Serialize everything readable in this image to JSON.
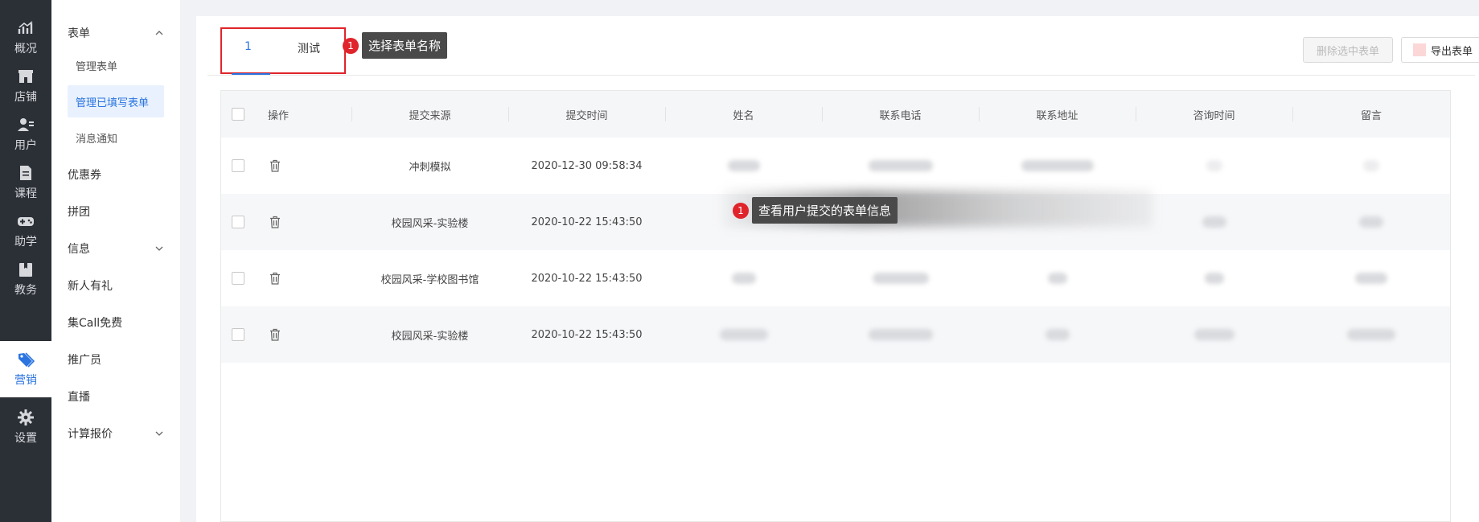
{
  "rail": {
    "items": [
      {
        "label": "概况",
        "icon": "chart-icon"
      },
      {
        "label": "店铺",
        "icon": "store-icon"
      },
      {
        "label": "用户",
        "icon": "users-icon"
      },
      {
        "label": "课程",
        "icon": "course-icon"
      },
      {
        "label": "助学",
        "icon": "gamepad-icon"
      },
      {
        "label": "教务",
        "icon": "book-icon"
      },
      {
        "label": "营销",
        "icon": "tag-icon",
        "active": true
      },
      {
        "label": "设置",
        "icon": "gear-icon"
      }
    ]
  },
  "submenu": {
    "form": "表单",
    "form_children": [
      "管理表单",
      "管理已填写表单",
      "消息通知"
    ],
    "coupon": "优惠券",
    "group": "拼团",
    "info": "信息",
    "newcomer": "新人有礼",
    "call": "集Call免费",
    "promoter": "推广员",
    "live": "直播",
    "quote": "计算报价"
  },
  "tabs": [
    "1",
    "测试"
  ],
  "callouts": {
    "tab_num": "1",
    "tab_text": "选择表单名称",
    "table_num": "1",
    "table_text": "查看用户提交的表单信息"
  },
  "buttons": {
    "delete_selected": "删除选中表单",
    "export": "导出表单"
  },
  "table": {
    "headers": [
      "操作",
      "提交来源",
      "提交时间",
      "姓名",
      "联系电话",
      "联系地址",
      "咨询时间",
      "留言"
    ],
    "rows": [
      {
        "source": "冲刺模拟",
        "time": "2020-12-30 09:58:34"
      },
      {
        "source": "校园风采-实验楼",
        "time": "2020-10-22 15:43:50"
      },
      {
        "source": "校园风采-学校图书馆",
        "time": "2020-10-22 15:43:50"
      },
      {
        "source": "校园风采-实验楼",
        "time": "2020-10-22 15:43:50"
      }
    ]
  },
  "colors": {
    "accent": "#2b74e0",
    "highlight": "#e0242b",
    "rail": "#2b2f36"
  }
}
